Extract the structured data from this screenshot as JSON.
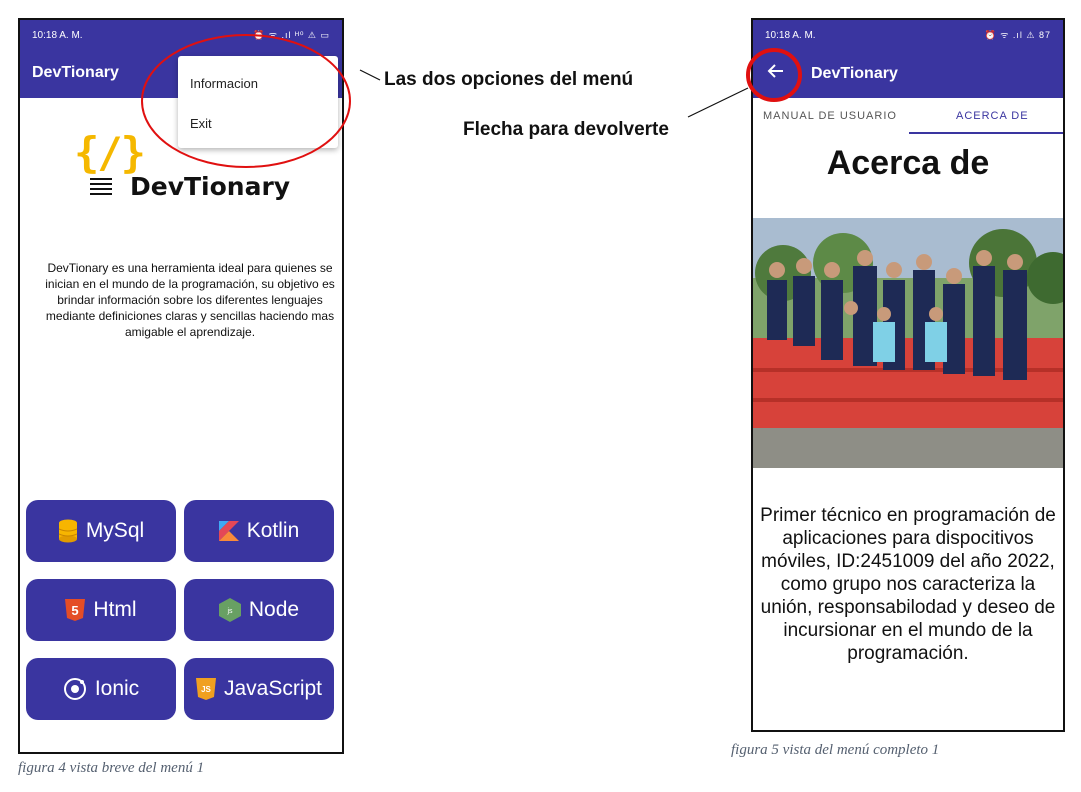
{
  "phone1": {
    "status": {
      "time": "10:18 A. M.",
      "icons": "⏰ ᯤ .ıl ᴴ⁰ ⚠ ▭"
    },
    "app_title": "DevTionary",
    "menu": [
      {
        "label": "Informacion"
      },
      {
        "label": "Exit"
      }
    ],
    "logo": {
      "brackets": "{/}",
      "text": "DevTionary"
    },
    "description": "DevTionary es una herramienta ideal para quienes se inician en el mundo de la programación, su objetivo es brindar información sobre los diferentes lenguajes mediante definiciones claras y sencillas haciendo mas amigable el aprendizaje.",
    "buttons": [
      {
        "label": "MySql",
        "icon": "database-icon"
      },
      {
        "label": "Kotlin",
        "icon": "kotlin-icon"
      },
      {
        "label": "Html",
        "icon": "html5-icon"
      },
      {
        "label": "Node",
        "icon": "nodejs-icon"
      },
      {
        "label": "Ionic",
        "icon": "ionic-icon"
      },
      {
        "label": "JavaScript",
        "icon": "javascript-icon"
      }
    ],
    "caption": "figura 4 vista breve del menú 1"
  },
  "annotations": {
    "menu_options": "Las dos opciones del menú",
    "back_arrow": "Flecha para devolverte"
  },
  "phone2": {
    "status": {
      "time": "10:18 A. M.",
      "icons": "⏰ ᯤ .ıl ⚠ 87"
    },
    "app_title": "DevTionary",
    "tabs": [
      {
        "label": "MANUAL DE USUARIO"
      },
      {
        "label": "ACERCA DE"
      }
    ],
    "page_title": "Acerca de",
    "about": "Primer técnico en programación de aplicaciones para dispocitivos móviles, ID:2451009 del año 2022, como grupo nos caracteriza la unión, responsabilodad y deseo de incursionar en el mundo de la programación.",
    "caption": "figura 5 vista del menú completo 1"
  },
  "colors": {
    "appbar": "#3a35a0",
    "accent_circle": "#e01010",
    "logo_yellow": "#f5b800"
  }
}
